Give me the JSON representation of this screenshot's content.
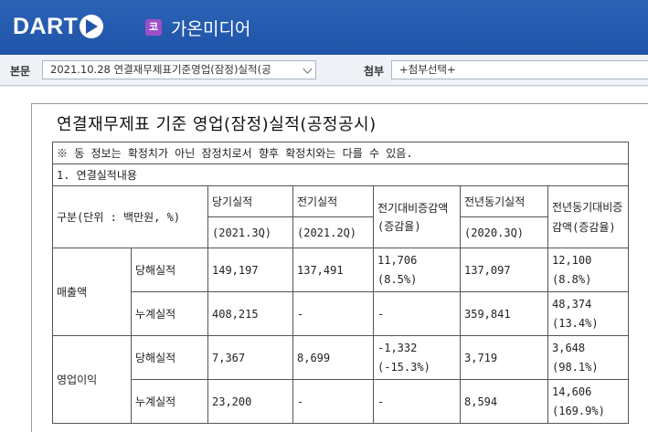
{
  "header": {
    "logo_text": "DART",
    "corp_badge": "코",
    "corp_name": "가온미디어"
  },
  "toolbar": {
    "body_label": "본문",
    "body_select_value": "2021.10.28  연결재무제표기준영업(잠정)실적(공",
    "attach_label": "첨부",
    "attach_select_value": "+첨부선택+"
  },
  "document": {
    "title": "연결재무제표 기준 영업(잠정)실적(공정공시)",
    "note": "※ 동 정보는 확정치가 아닌 잠정치로서 향후 확정치와는 다를 수 있음.",
    "section": "1. 연결실적내용",
    "table": {
      "unit_header": "구분(단위 : 백만원, %)",
      "current": "당기실적",
      "current_period": "(2021.3Q)",
      "previous": "전기실적",
      "previous_period": "(2021.2Q)",
      "qoq": "전기대비증감액(증감율)",
      "yoy_base": "전년동기실적",
      "yoy_period": "(2020.3Q)",
      "yoy": "전년동기대비증감액(증감율)",
      "groups": [
        {
          "name": "매출액",
          "rows": [
            {
              "label": "당해실적",
              "current": "149,197",
              "previous": "137,491",
              "qoq_amt": "11,706",
              "qoq_rate": "(8.5%)",
              "yoy_base": "137,097",
              "yoy_amt": "12,100",
              "yoy_rate": "(8.8%)"
            },
            {
              "label": "누계실적",
              "current": "408,215",
              "previous": "-",
              "qoq_amt": "-",
              "qoq_rate": "",
              "yoy_base": "359,841",
              "yoy_amt": "48,374",
              "yoy_rate": "(13.4%)"
            }
          ]
        },
        {
          "name": "영업이익",
          "rows": [
            {
              "label": "당해실적",
              "current": "7,367",
              "previous": "8,699",
              "qoq_amt": "-1,332",
              "qoq_rate": "(-15.3%)",
              "yoy_base": "3,719",
              "yoy_amt": "3,648",
              "yoy_rate": "(98.1%)"
            },
            {
              "label": "누계실적",
              "current": "23,200",
              "previous": "-",
              "qoq_amt": "-",
              "qoq_rate": "",
              "yoy_base": "8,594",
              "yoy_amt": "14,606",
              "yoy_rate": "(169.9%)"
            }
          ]
        }
      ]
    }
  }
}
